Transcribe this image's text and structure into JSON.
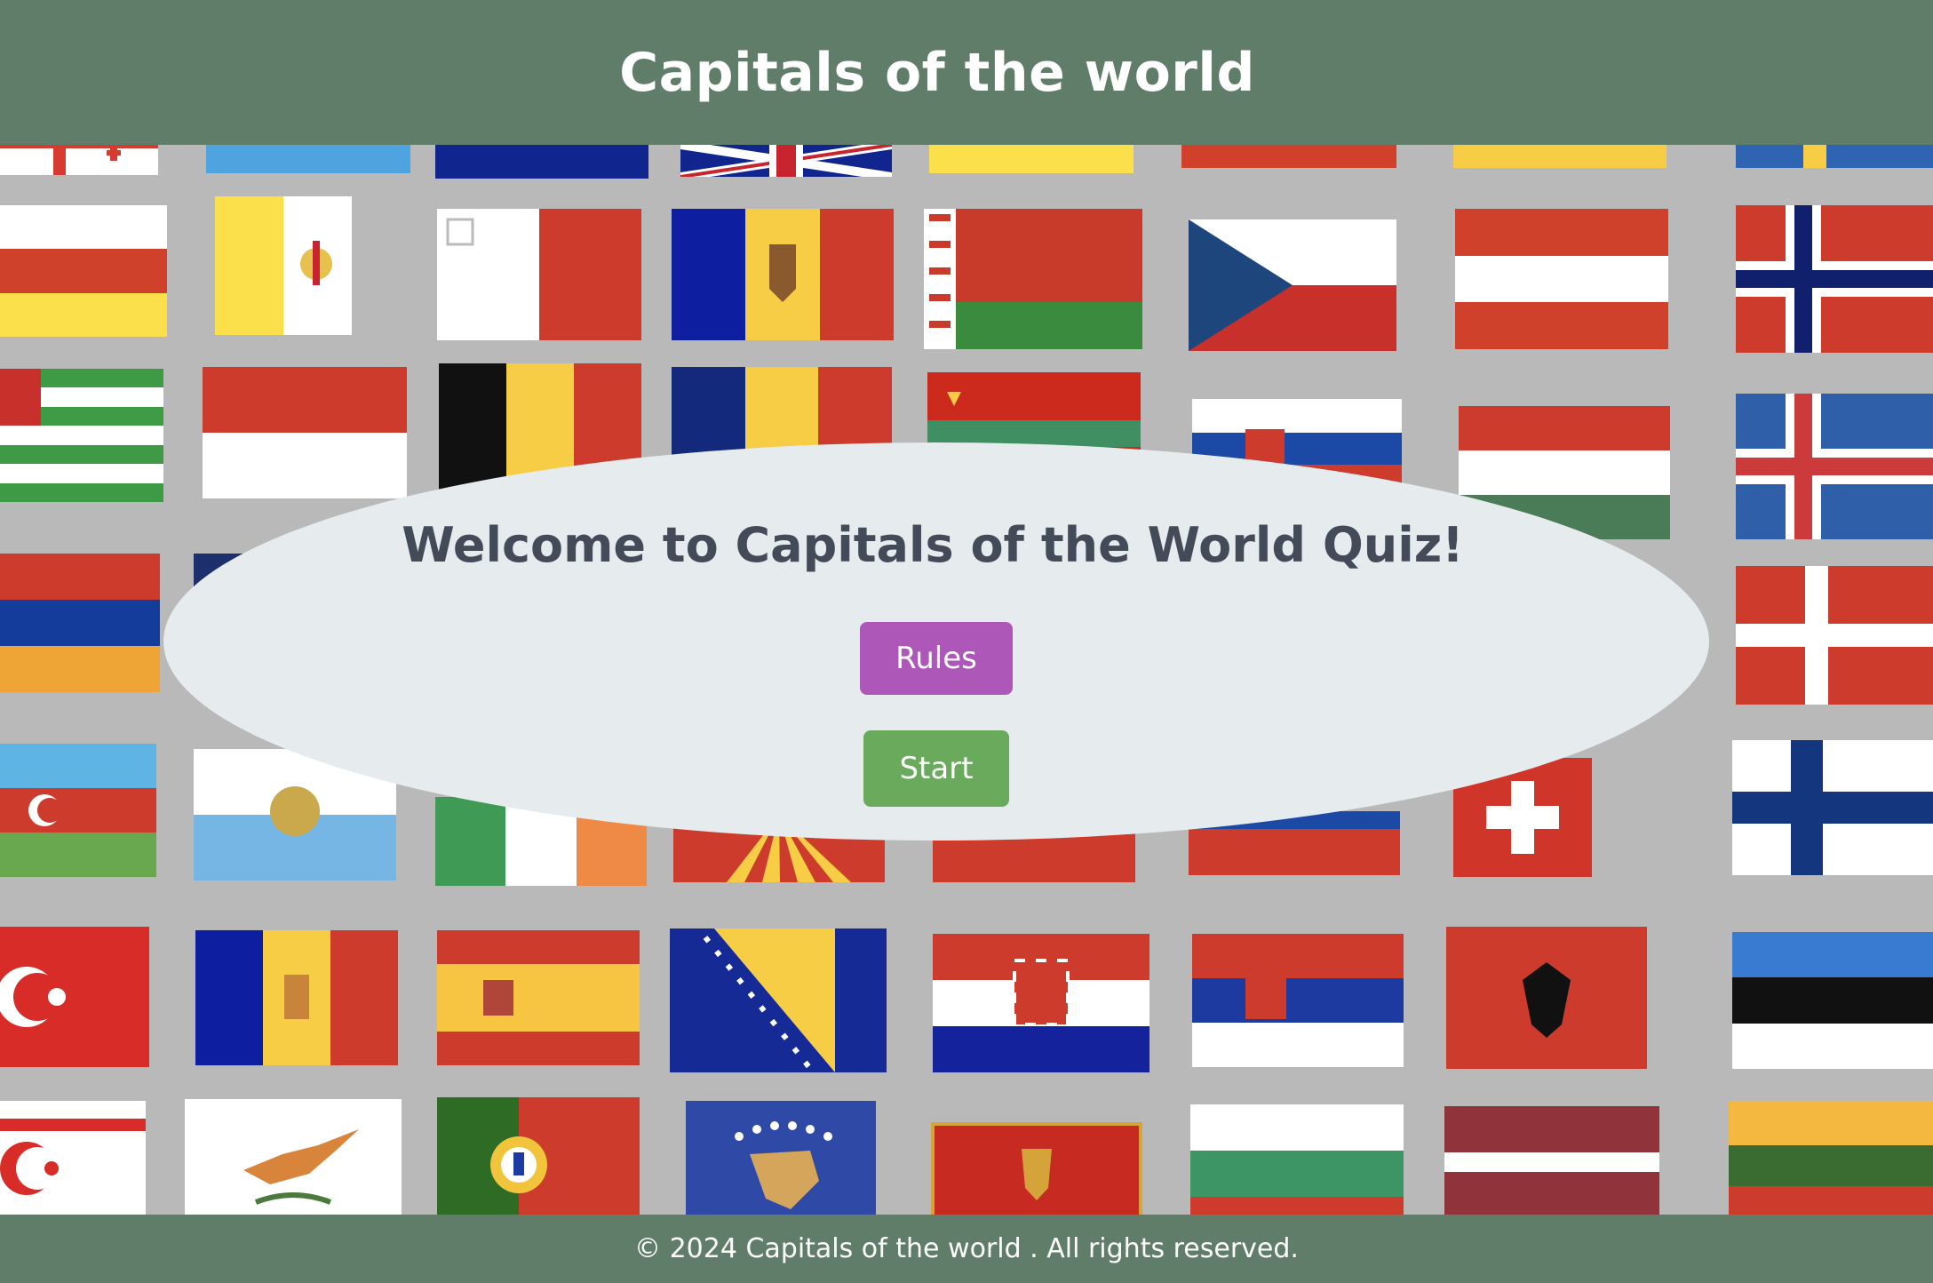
{
  "header": {
    "title": "Capitals of the world"
  },
  "main": {
    "welcome": "Welcome to Capitals of the World Quiz!",
    "rules_label": "Rules",
    "start_label": "Start"
  },
  "footer": {
    "copyright": "© 2024 Capitals of the world . All rights reserved."
  },
  "colors": {
    "header_bg": "#607d69",
    "panel_bg": "#e6ebee",
    "rules_button": "#ad57b8",
    "start_button": "#69aa5c",
    "background": "#b9b9b9"
  },
  "background_flags": [
    "georgia-flag",
    "ukraine-flag",
    "uk-flag",
    "south-ossetia-flag",
    "vatican-flag",
    "malta-flag",
    "moldova-flag",
    "belarus-flag",
    "czech-flag",
    "austria-flag",
    "norway-flag",
    "abkhazia-flag",
    "monaco-flag",
    "belgium-flag",
    "romania-flag",
    "transnistria-flag",
    "slovakia-flag",
    "hungary-flag",
    "iceland-flag",
    "armenia-flag",
    "denmark-flag",
    "azerbaijan-flag",
    "san-marino-flag",
    "ireland-flag",
    "north-macedonia-flag",
    "switzerland-flag",
    "finland-flag",
    "turkey-flag",
    "andorra-flag",
    "spain-flag",
    "bosnia-flag",
    "croatia-flag",
    "serbia-flag",
    "albania-flag",
    "estonia-flag",
    "northern-cyprus-flag",
    "cyprus-flag",
    "portugal-flag",
    "kosovo-flag",
    "montenegro-flag",
    "bulgaria-flag",
    "latvia-flag",
    "lithuania-flag"
  ]
}
